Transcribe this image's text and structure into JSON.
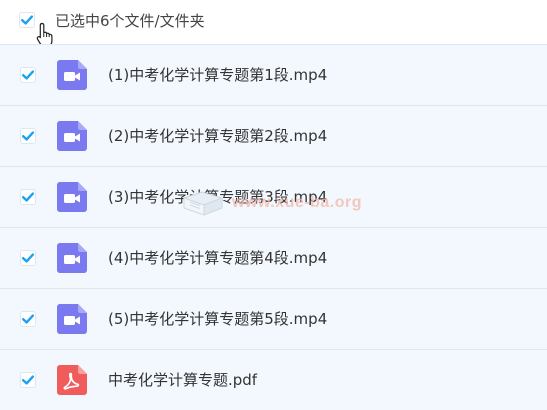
{
  "header": {
    "selected_text": "已选中6个文件/文件夹",
    "select_all_checked": true
  },
  "files": [
    {
      "name": "(1)中考化学计算专题第1段.mp4",
      "type": "video",
      "checked": true
    },
    {
      "name": "(2)中考化学计算专题第2段.mp4",
      "type": "video",
      "checked": true
    },
    {
      "name": "(3)中考化学计算专题第3段.mp4",
      "type": "video",
      "checked": true
    },
    {
      "name": "(4)中考化学计算专题第4段.mp4",
      "type": "video",
      "checked": true
    },
    {
      "name": "(5)中考化学计算专题第5段.mp4",
      "type": "video",
      "checked": true
    },
    {
      "name": "中考化学计算专题.pdf",
      "type": "pdf",
      "checked": true
    }
  ],
  "watermark": {
    "text": "www.xue-ba.org"
  },
  "colors": {
    "checkbox_check": "#1aa1f0",
    "checkbox_border": "#dfe6ee",
    "video_icon": "#7a79f0",
    "pdf_icon": "#f05b5b",
    "row_background": "#f2f8fe",
    "row_border": "#dbe7f3"
  },
  "icons": {
    "video": "video-file-icon",
    "pdf": "pdf-file-icon",
    "cursor": "hand-pointer-icon"
  }
}
